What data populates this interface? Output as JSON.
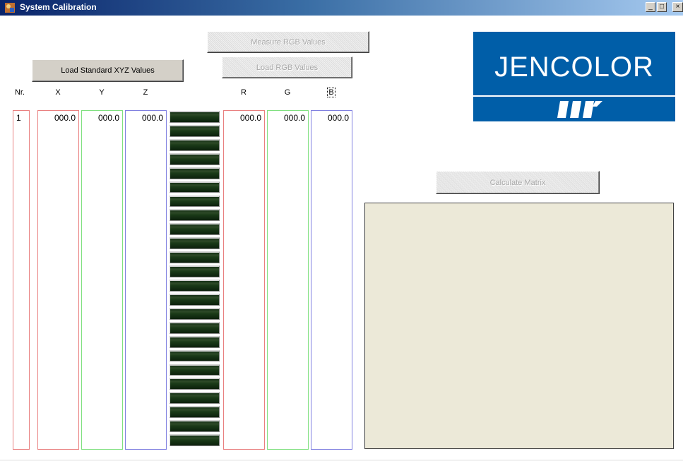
{
  "window": {
    "title": "System Calibration",
    "minimize": "_",
    "maximize": "□",
    "close": "×"
  },
  "buttons": {
    "load_xyz": "Load Standard XYZ Values",
    "measure_rgb": "Measure RGB Values",
    "load_rgb": "Load RGB Values",
    "calc_matrix": "Calculate Matrix"
  },
  "headers": {
    "nr": "Nr.",
    "x": "X",
    "y": "Y",
    "z": "Z",
    "r": "R",
    "g": "G",
    "b": "B"
  },
  "row": {
    "nr": "1",
    "x": "000.0",
    "y": "000.0",
    "z": "000.0",
    "r": "000.0",
    "g": "000.0",
    "b": "000.0"
  },
  "logo": {
    "text": "JENCOLOR"
  },
  "led_count": 24,
  "colors": {
    "nr_border": "#e98080",
    "x_border": "#e98080",
    "y_border": "#80e080",
    "z_border": "#8080e0",
    "r_border": "#e98080",
    "g_border": "#80e080",
    "b_border": "#8080e0",
    "logo_blue": "#005ea8",
    "panel_bg": "#ece9d8"
  }
}
